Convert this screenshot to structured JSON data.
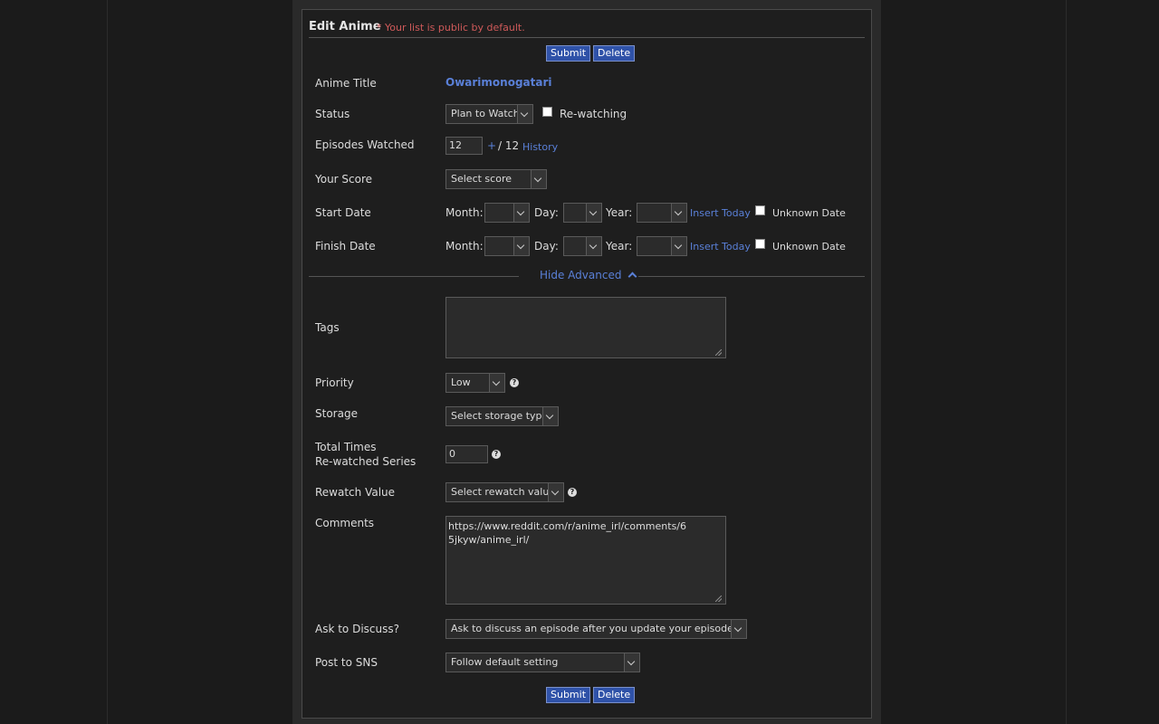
{
  "header": {
    "title": "Edit Anime",
    "note": "* Your list is public by default."
  },
  "buttons": {
    "submit": "Submit",
    "delete": "Delete"
  },
  "fields": {
    "anime_title": {
      "label": "Anime Title",
      "value": "Owarimonogatari"
    },
    "status": {
      "label": "Status",
      "value": "Plan to Watch",
      "rewatching_label": "Re-watching"
    },
    "episodes": {
      "label": "Episodes Watched",
      "value": "12",
      "plus": "+",
      "total": "/ 12",
      "history": "History"
    },
    "score": {
      "label": "Your Score",
      "value": "Select score"
    },
    "start_date": {
      "label": "Start Date",
      "month": "Month:",
      "day": "Day:",
      "year": "Year:",
      "insert_today": "Insert Today",
      "unknown": "Unknown Date"
    },
    "finish_date": {
      "label": "Finish Date",
      "month": "Month:",
      "day": "Day:",
      "year": "Year:",
      "insert_today": "Insert Today",
      "unknown": "Unknown Date"
    }
  },
  "advanced": {
    "toggle": "Hide Advanced",
    "tags": {
      "label": "Tags",
      "value": ""
    },
    "priority": {
      "label": "Priority",
      "value": "Low"
    },
    "storage": {
      "label": "Storage",
      "value": "Select storage type"
    },
    "rewatched": {
      "label_line1": "Total Times",
      "label_line2": "Re-watched Series",
      "value": "0"
    },
    "rewatch_value": {
      "label": "Rewatch Value",
      "value": "Select rewatch value"
    },
    "comments": {
      "label": "Comments",
      "value": "https://www.reddit.com/r/anime_irl/comments/65jkyw/anime_irl/"
    },
    "discuss": {
      "label": "Ask to Discuss?",
      "value": "Ask to discuss an episode after you update your episode count"
    },
    "sns": {
      "label": "Post to SNS",
      "value": "Follow default setting"
    }
  },
  "colors": {
    "accent_link": "#5a80d8",
    "button_bg": "#2f52a8",
    "note_red": "#d05a5a",
    "background": "#1b1b1b"
  }
}
